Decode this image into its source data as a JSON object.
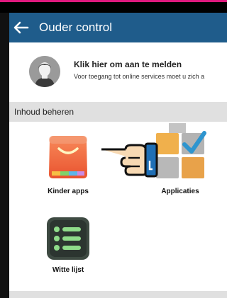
{
  "appbar": {
    "title": "Ouder control",
    "color": "#1f5c8b"
  },
  "login": {
    "title": "Klik hier om aan te melden",
    "subtitle": "Voor toegang tot online services moet u zich a"
  },
  "sections": {
    "manage": "Inhoud beheren"
  },
  "tiles": [
    {
      "label": "Kinder apps",
      "icon": "shopping-bag-icon"
    },
    {
      "label": "Applicaties",
      "icon": "applications-grid-icon"
    },
    {
      "label": "Witte lijst",
      "icon": "whitelist-icon"
    }
  ],
  "colors": {
    "frame": "#e0197e",
    "section_bg": "#e0e0e0"
  }
}
